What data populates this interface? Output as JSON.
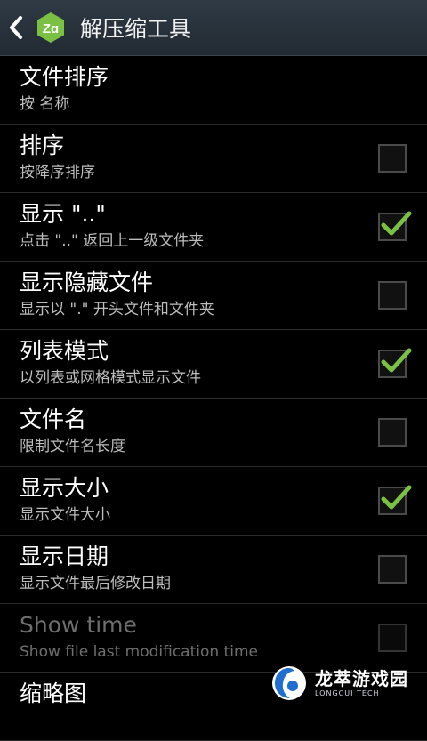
{
  "header": {
    "title": "解压缩工具",
    "logo_text": "Zɑ",
    "accent_color": "#7ac143",
    "back_icon": "chevron-left-icon"
  },
  "settings": [
    {
      "title": "文件排序",
      "subtitle": "按 名称",
      "has_checkbox": false
    },
    {
      "title": "排序",
      "subtitle": "按降序排序",
      "checked": false
    },
    {
      "title": "显示 \"..\"",
      "subtitle": "点击 \"..\" 返回上一级文件夹",
      "checked": true
    },
    {
      "title": "显示隐藏文件",
      "subtitle": "显示以 \".\" 开头文件和文件夹",
      "checked": false
    },
    {
      "title": "列表模式",
      "subtitle": "以列表或网格模式显示文件",
      "checked": true
    },
    {
      "title": "文件名",
      "subtitle": "限制文件名长度",
      "checked": false
    },
    {
      "title": "显示大小",
      "subtitle": "显示文件大小",
      "checked": true
    },
    {
      "title": "显示日期",
      "subtitle": "显示文件最后修改日期",
      "checked": false
    },
    {
      "title": "Show time",
      "subtitle": "Show file last modification time",
      "checked": false,
      "disabled": true
    },
    {
      "title": "缩略图",
      "subtitle": "",
      "checked": false
    }
  ],
  "watermark": {
    "text_cn": "龙萃游戏园",
    "text_en": "LONGCUI TECH"
  },
  "colors": {
    "check": "#7ac143",
    "background": "#000000"
  }
}
